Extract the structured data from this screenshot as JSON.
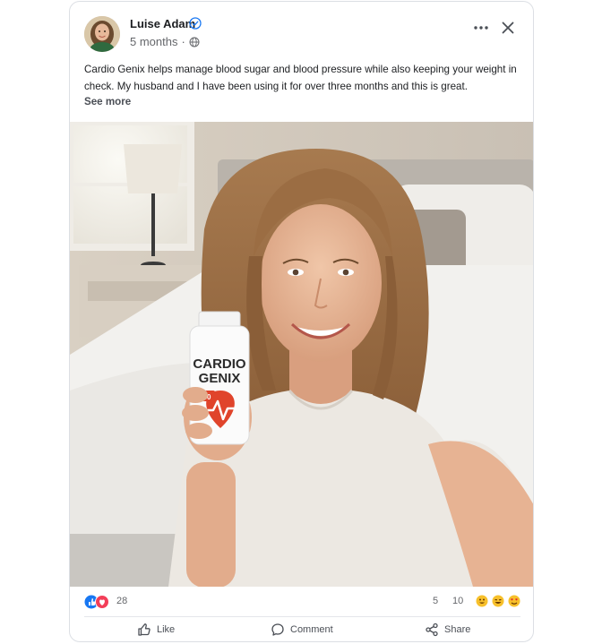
{
  "post": {
    "author": "Luise Adam",
    "time": "5 months",
    "separator": "·",
    "text": "Cardio Genix helps manage blood sugar and blood pressure while also keeping your weight in check. My husband and I have been using it for over three months and this is great.",
    "see_more": "See more"
  },
  "photo": {
    "product_brand_line1": "CARDIO",
    "product_brand_line2": "GENIX",
    "product_count": "60"
  },
  "stats": {
    "reactions": "28",
    "comments": "5",
    "shares": "10"
  },
  "actions": {
    "like": "Like",
    "comment": "Comment",
    "share": "Share"
  },
  "colors": {
    "accent_blue": "#1877f2",
    "love_red": "#f33e58",
    "product_red": "#e0442b"
  }
}
